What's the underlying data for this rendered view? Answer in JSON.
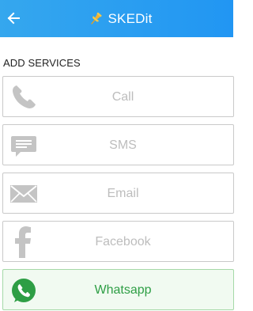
{
  "appbar": {
    "title": "SKEDit",
    "bg_color": "#2196f3",
    "logo_icon": "pin-icon",
    "back_icon": "arrow-left-icon"
  },
  "section": {
    "title": "ADD SERVICES"
  },
  "services": [
    {
      "label": "Call",
      "icon": "phone-icon",
      "active": false
    },
    {
      "label": "SMS",
      "icon": "chat-bubble-icon",
      "active": false
    },
    {
      "label": "Email",
      "icon": "envelope-icon",
      "active": false
    },
    {
      "label": "Facebook",
      "icon": "facebook-icon",
      "active": false
    },
    {
      "label": "Whatsapp",
      "icon": "whatsapp-icon",
      "active": true
    }
  ],
  "colors": {
    "inactive_text": "#bdbdbd",
    "inactive_icon": "#c4c4c4",
    "whatsapp_green": "#2e9e45"
  }
}
